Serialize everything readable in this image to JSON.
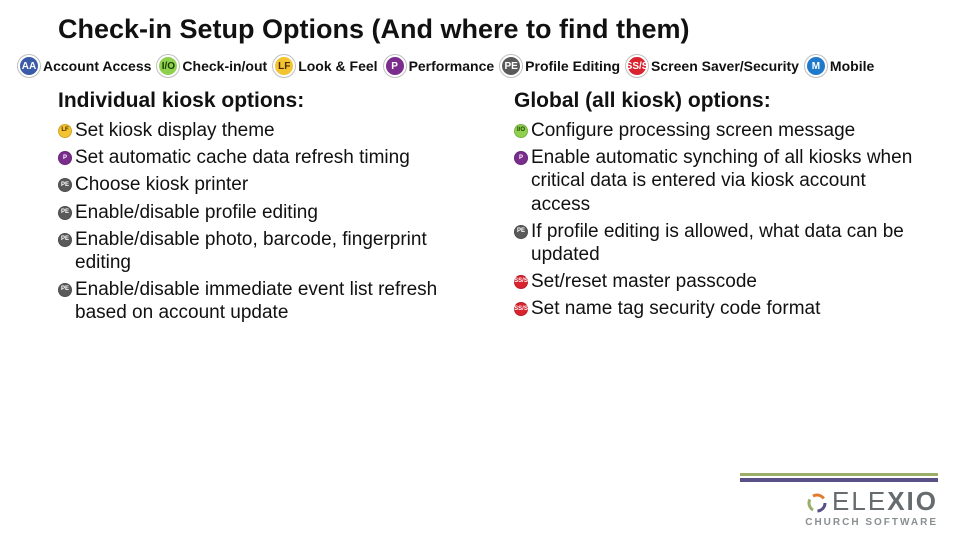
{
  "title": "Check-in Setup Options (And where to find them)",
  "legend": {
    "aa": "Account Access",
    "io": "Check-in/out",
    "lf": "Look & Feel",
    "p": "Performance",
    "pe": "Profile Editing",
    "ss": "Screen Saver/Security",
    "m": "Mobile"
  },
  "badges": {
    "aa": "AA",
    "io": "I/O",
    "lf": "LF",
    "p": "P",
    "pe": "PE",
    "ss": "SS/S",
    "m": "M"
  },
  "left": {
    "heading": "Individual kiosk options:",
    "items": [
      {
        "tag": "lf",
        "text": "Set kiosk display theme"
      },
      {
        "tag": "p",
        "text": "Set automatic cache data refresh timing"
      },
      {
        "tag": "pe",
        "text": "Choose kiosk printer"
      },
      {
        "tag": "pe",
        "text": "Enable/disable profile editing"
      },
      {
        "tag": "pe",
        "text": "Enable/disable photo, barcode, fingerprint editing"
      },
      {
        "tag": "pe",
        "text": "Enable/disable immediate event list refresh based on account update"
      }
    ]
  },
  "right": {
    "heading": "Global (all kiosk) options:",
    "items": [
      {
        "tag": "io",
        "text": "Configure processing screen message"
      },
      {
        "tag": "p",
        "text": "Enable automatic synching of all kiosks when critical data is entered via kiosk account access"
      },
      {
        "tag": "pe",
        "text": "If profile editing is allowed, what data can be updated"
      },
      {
        "tag": "ss",
        "text": "Set/reset master passcode"
      },
      {
        "tag": "ss",
        "text": "Set name tag security code format"
      }
    ]
  },
  "logo": {
    "name_left": "ELE",
    "name_right": "XIO",
    "sub": "CHURCH SOFTWARE"
  }
}
